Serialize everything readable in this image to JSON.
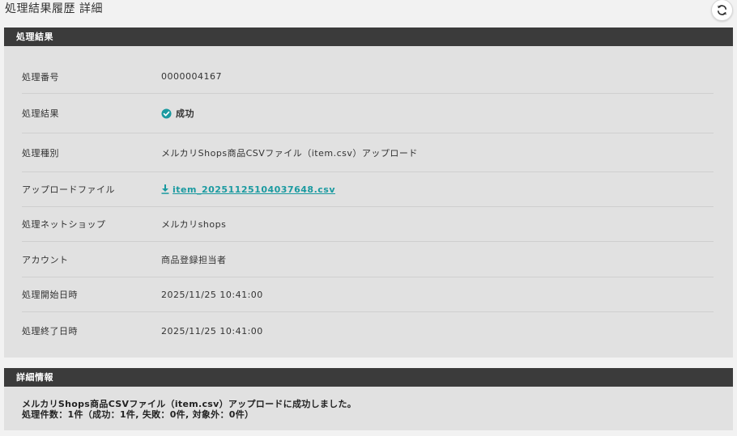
{
  "page": {
    "title": "処理結果履歴 詳細"
  },
  "result_section": {
    "header": "処理結果",
    "rows": [
      {
        "label": "処理番号",
        "value": "0000004167"
      },
      {
        "label": "処理結果",
        "value": "成功",
        "icon": "check-circle-icon",
        "status_color": "#1a9aa0"
      },
      {
        "label": "処理種別",
        "value": "メルカリShops商品CSVファイル（item.csv）アップロード"
      },
      {
        "label": "アップロードファイル",
        "value": "item_20251125104037648.csv",
        "icon": "download-icon",
        "link_color": "#1a9aa0"
      },
      {
        "label": "処理ネットショップ",
        "value": "メルカリshops"
      },
      {
        "label": "アカウント",
        "value": "商品登録担当者"
      },
      {
        "label": "処理開始日時",
        "value": "2025/11/25 10:41:00"
      },
      {
        "label": "処理終了日時",
        "value": "2025/11/25 10:41:00"
      }
    ]
  },
  "detail_section": {
    "header": "詳細情報",
    "lines": [
      "メルカリShops商品CSVファイル（item.csv）アップロードに成功しました。",
      "処理件数：1件（成功：1件, 失敗：0件, 対象外：0件）"
    ]
  },
  "colors": {
    "header_bg": "#3b3b3b",
    "section_bg": "#e1e1e1",
    "accent": "#1a9aa0"
  },
  "icons": {
    "refresh": "refresh-icon"
  }
}
